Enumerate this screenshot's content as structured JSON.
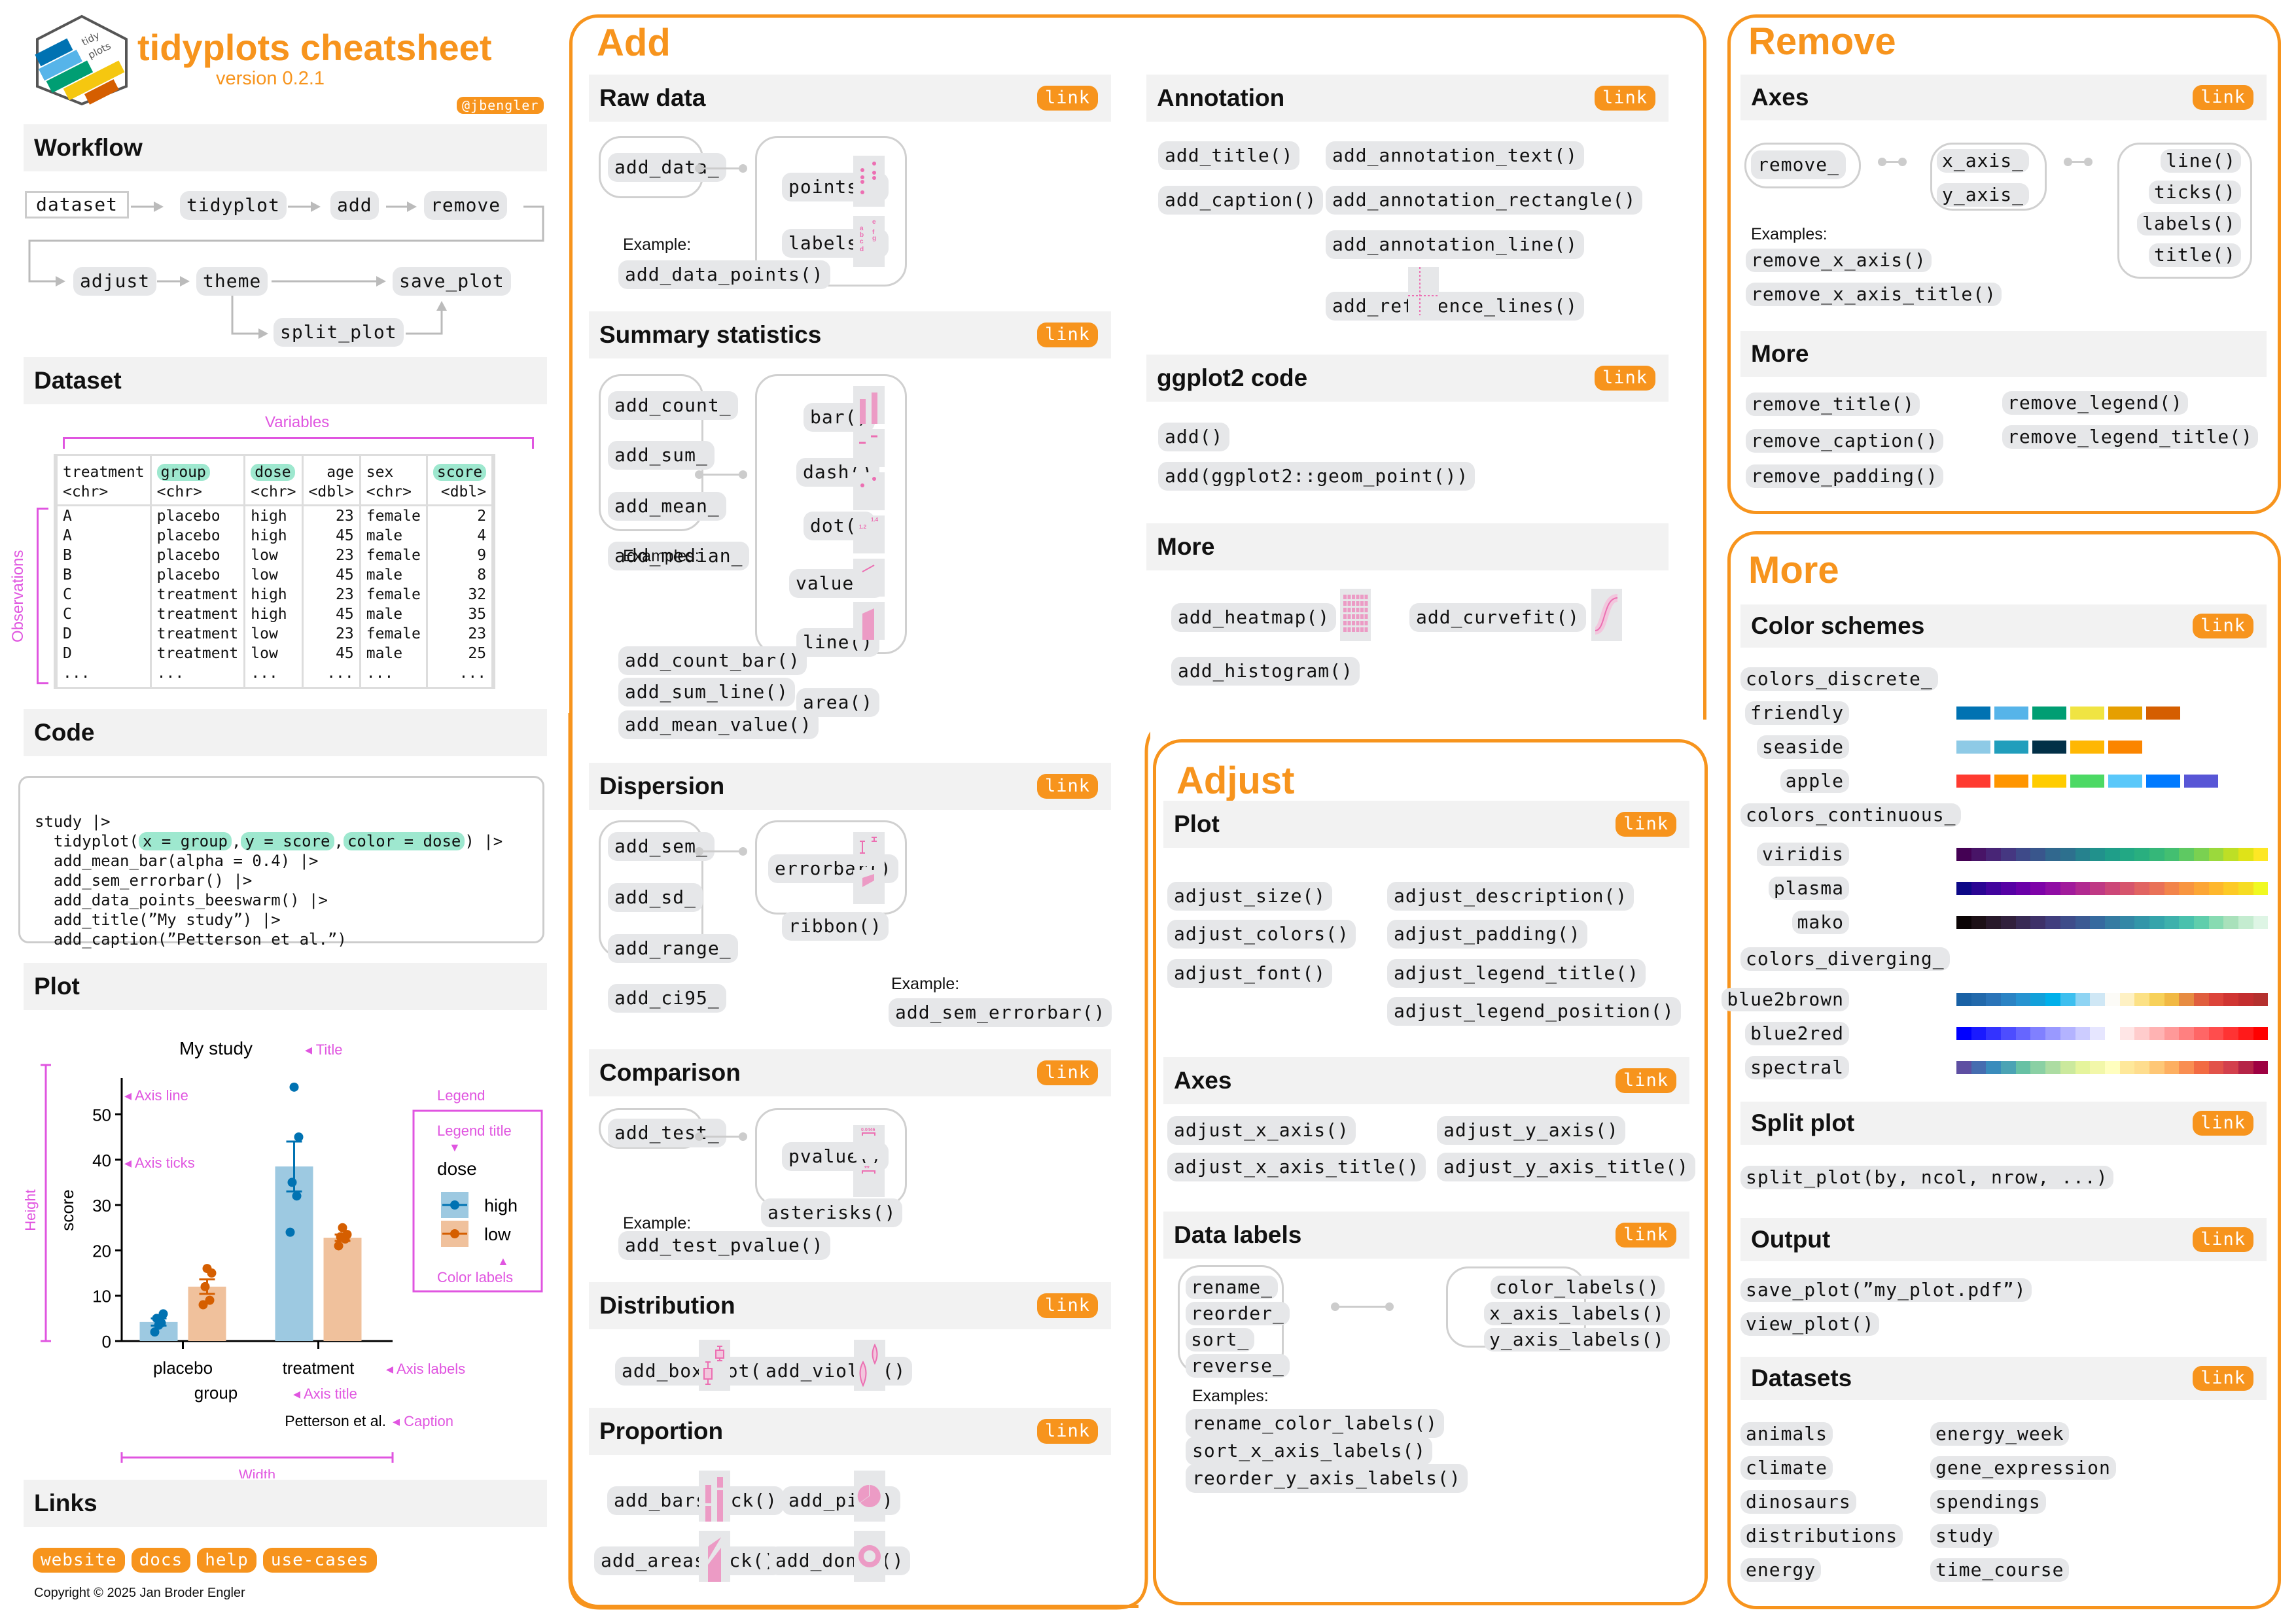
{
  "header": {
    "title": "tidyplots cheatsheet",
    "version": "version 0.2.1",
    "handle": "@jbengler",
    "logo_text": [
      "tidy",
      "plots"
    ],
    "logo_colors": [
      "#0072b2",
      "#56b4e9",
      "#009e73",
      "#f5c710",
      "#d55e00"
    ]
  },
  "accent_color": "#f7941d",
  "annotation_color": "#e055e0",
  "workflow": {
    "title": "Workflow",
    "steps": [
      "dataset",
      "tidyplot",
      "add",
      "remove",
      "adjust",
      "theme",
      "save_plot",
      "split_plot"
    ]
  },
  "dataset": {
    "title": "Dataset",
    "variables_label": "Variables",
    "observations_label": "Observations",
    "columns": [
      {
        "name": "treatment",
        "type": "<chr>",
        "highlight": false,
        "align": "left"
      },
      {
        "name": "group",
        "type": "<chr>",
        "highlight": true,
        "align": "left"
      },
      {
        "name": "dose",
        "type": "<chr>",
        "highlight": true,
        "align": "left"
      },
      {
        "name": "age",
        "type": "<dbl>",
        "highlight": false,
        "align": "right"
      },
      {
        "name": "sex",
        "type": "<chr>",
        "highlight": false,
        "align": "left"
      },
      {
        "name": "score",
        "type": "<dbl>",
        "highlight": true,
        "align": "right"
      }
    ],
    "rows": [
      [
        "A",
        "placebo",
        "high",
        "23",
        "female",
        "2"
      ],
      [
        "A",
        "placebo",
        "high",
        "45",
        "male",
        "4"
      ],
      [
        "B",
        "placebo",
        "low",
        "23",
        "female",
        "9"
      ],
      [
        "B",
        "placebo",
        "low",
        "45",
        "male",
        "8"
      ],
      [
        "C",
        "treatment",
        "high",
        "23",
        "female",
        "32"
      ],
      [
        "C",
        "treatment",
        "high",
        "45",
        "male",
        "35"
      ],
      [
        "D",
        "treatment",
        "low",
        "23",
        "female",
        "23"
      ],
      [
        "D",
        "treatment",
        "low",
        "45",
        "male",
        "25"
      ],
      [
        "...",
        "...",
        "...",
        "...",
        "...",
        "..."
      ]
    ]
  },
  "code": {
    "title": "Code",
    "line1": "study |>",
    "line2_pre": "tidyplot(",
    "line2_h1": "x = group",
    "line2_h2": "y = score",
    "line2_h3": "color = dose",
    "line2_post": ") |>",
    "lines": [
      "add_mean_bar(alpha = 0.4) |>",
      "add_sem_errorbar() |>",
      "add_data_points_beeswarm() |>",
      "add_title(”My study”) |>",
      "add_caption(”Petterson et al.”)"
    ]
  },
  "plot": {
    "title": "Plot",
    "annotations": {
      "title": "Title",
      "axis_line": "Axis line",
      "axis_ticks": "Axis ticks",
      "legend": "Legend",
      "legend_title": "Legend title",
      "color_labels": "Color labels",
      "axis_labels": "Axis labels",
      "axis_title": "Axis title",
      "caption": "Caption",
      "height": "Height",
      "width": "Width"
    }
  },
  "chart_data": {
    "type": "bar",
    "title": "My study",
    "caption": "Petterson et al.",
    "xlabel": "group",
    "ylabel": "score",
    "categories": [
      "placebo",
      "treatment"
    ],
    "ylim": [
      0,
      58
    ],
    "yticks": [
      0,
      10,
      20,
      30,
      40,
      50
    ],
    "legend": {
      "title": "dose",
      "position": "right"
    },
    "series": [
      {
        "name": "high",
        "color": "#0072b2",
        "fill": "#9dc9e1",
        "values": [
          4.2,
          38.5
        ],
        "sem": [
          0.8,
          5.5
        ],
        "points": [
          [
            2,
            4,
            5,
            6,
            3.5
          ],
          [
            24,
            32,
            35,
            45,
            56
          ]
        ]
      },
      {
        "name": "low",
        "color": "#d55e00",
        "fill": "#f0c19c",
        "values": [
          12,
          22.8
        ],
        "sem": [
          1.6,
          0.7
        ],
        "points": [
          [
            8,
            9,
            12,
            15,
            16
          ],
          [
            21,
            22.5,
            23,
            23.5,
            25
          ]
        ]
      }
    ]
  },
  "links": {
    "title": "Links",
    "items": [
      "website",
      "docs",
      "help",
      "use-cases"
    ],
    "copyright": "Copyright © 2025 Jan Broder Engler"
  },
  "add": {
    "title": "Add",
    "raw_data": {
      "title": "Raw data",
      "link": "link",
      "prefix": "add_data_",
      "suffixes": [
        "points()",
        "labels()"
      ],
      "example_label": "Example:",
      "examples": [
        "add_data_points()"
      ]
    },
    "summary": {
      "title": "Summary statistics",
      "link": "link",
      "prefixes": [
        "add_count_",
        "add_sum_",
        "add_mean_",
        "add_median_"
      ],
      "suffixes": [
        "bar()",
        "dash()",
        "dot()",
        "value()",
        "line()",
        "area()"
      ],
      "example_label": "Examples:",
      "examples": [
        "add_count_bar()",
        "add_sum_line()",
        "add_mean_value()"
      ],
      "value_icon_labels": [
        "1.2",
        "1.4"
      ]
    },
    "dispersion": {
      "title": "Dispersion",
      "link": "link",
      "prefixes": [
        "add_sem_",
        "add_sd_",
        "add_range_",
        "add_ci95_"
      ],
      "suffixes": [
        "errorbar()",
        "ribbon()"
      ],
      "example_label": "Example:",
      "examples": [
        "add_sem_errorbar()"
      ]
    },
    "comparison": {
      "title": "Comparison",
      "link": "link",
      "prefix": "add_test_",
      "suffixes": [
        "pvalue()",
        "asterisks()"
      ],
      "example_label": "Example:",
      "examples": [
        "add_test_pvalue()"
      ],
      "pvalue_icon_label": "0.0446",
      "asterisks_icon_label": "**"
    },
    "distribution": {
      "title": "Distribution",
      "link": "link",
      "items": [
        "add_boxplot()",
        "add_violin()"
      ]
    },
    "proportion": {
      "title": "Proportion",
      "link": "link",
      "items": [
        "add_barstack()",
        "add_pie()",
        "add_areastack()",
        "add_donut()"
      ]
    },
    "annotation": {
      "title": "Annotation",
      "link": "link",
      "items": [
        "add_title()",
        "add_annotation_text()",
        "add_caption()",
        "add_annotation_rectangle()",
        "add_annotation_line()",
        "add_reference_lines()"
      ]
    },
    "ggplot2": {
      "title": "ggplot2 code",
      "link": "link",
      "items": [
        "add()",
        "add(ggplot2::geom_point())"
      ]
    },
    "more": {
      "title": "More",
      "items": [
        "add_heatmap()",
        "add_curvefit()",
        "add_histogram()"
      ]
    }
  },
  "adjust": {
    "title": "Adjust",
    "plot": {
      "title": "Plot",
      "link": "link",
      "items": [
        "adjust_size()",
        "adjust_description()",
        "adjust_colors()",
        "adjust_padding()",
        "adjust_font()",
        "adjust_legend_title()",
        "adjust_legend_position()"
      ]
    },
    "axes": {
      "title": "Axes",
      "link": "link",
      "items": [
        "adjust_x_axis()",
        "adjust_y_axis()",
        "adjust_x_axis_title()",
        "adjust_y_axis_title()"
      ]
    },
    "data_labels": {
      "title": "Data labels",
      "link": "link",
      "prefixes": [
        "rename_",
        "reorder_",
        "sort_",
        "reverse_"
      ],
      "suffixes": [
        "color_labels()",
        "x_axis_labels()",
        "y_axis_labels()"
      ],
      "example_label": "Examples:",
      "examples": [
        "rename_color_labels()",
        "sort_x_axis_labels()",
        "reorder_y_axis_labels()"
      ]
    }
  },
  "remove": {
    "title": "Remove",
    "axes": {
      "title": "Axes",
      "link": "link",
      "prefix": "remove_",
      "middle": [
        "x_axis_",
        "y_axis_"
      ],
      "suffixes": [
        "line()",
        "ticks()",
        "labels()",
        "title()"
      ],
      "example_label": "Examples:",
      "examples": [
        "remove_x_axis()",
        "remove_x_axis_title()"
      ]
    },
    "more": {
      "title": "More",
      "items": [
        "remove_title()",
        "remove_legend()",
        "remove_caption()",
        "remove_legend_title()",
        "remove_padding()"
      ]
    }
  },
  "more": {
    "title": "More",
    "color_schemes": {
      "title": "Color schemes",
      "link": "link",
      "discrete_label": "colors_discrete_",
      "discrete": [
        {
          "name": "friendly",
          "colors": [
            "#0072b2",
            "#56b4e9",
            "#009e73",
            "#f0e442",
            "#e69f00",
            "#d55e00"
          ]
        },
        {
          "name": "seaside",
          "colors": [
            "#8ecae6",
            "#219ebc",
            "#023047",
            "#ffb703",
            "#fb8500"
          ]
        },
        {
          "name": "apple",
          "colors": [
            "#ff3b30",
            "#ff9500",
            "#ffcc00",
            "#4cd964",
            "#5ac8fa",
            "#007aff",
            "#5856d6"
          ]
        }
      ],
      "continuous_label": "colors_continuous_",
      "continuous": [
        {
          "name": "viridis",
          "colors": [
            "#440154",
            "#481467",
            "#482576",
            "#453781",
            "#3e4a89",
            "#39568c",
            "#31688e",
            "#2d708e",
            "#26828e",
            "#21918c",
            "#1f9e89",
            "#22a884",
            "#29af7f",
            "#35b779",
            "#43bf71",
            "#5ec962",
            "#7ad151",
            "#9bd93c",
            "#bddf26",
            "#dfe318",
            "#fde725"
          ]
        },
        {
          "name": "plasma",
          "colors": [
            "#0d0887",
            "#2a0593",
            "#41049d",
            "#5601a4",
            "#6a00a8",
            "#7e03a8",
            "#8f0da4",
            "#a11b9b",
            "#b12a90",
            "#bf3984",
            "#cc4778",
            "#d6556d",
            "#e16462",
            "#e97158",
            "#f2844b",
            "#f89540",
            "#fca636",
            "#feb72d",
            "#fdca26",
            "#f6dc22",
            "#f0f921"
          ]
        },
        {
          "name": "mako",
          "colors": [
            "#0b0405",
            "#1c1016",
            "#28192a",
            "#31203c",
            "#382a54",
            "#3e3169",
            "#413e7e",
            "#3e4c8a",
            "#3b5a93",
            "#366a9f",
            "#357ba2",
            "#3487a6",
            "#3396a9",
            "#35a4ab",
            "#3eb1ac",
            "#49c1ad",
            "#60ceac",
            "#87dbb2",
            "#a9e1bb",
            "#c4ecd0",
            "#def5e5"
          ]
        }
      ],
      "diverging_label": "colors_diverging_",
      "diverging": [
        {
          "name": "blue2brown",
          "colors": [
            "#1961a5",
            "#2269ab",
            "#2a74b8",
            "#2b83c4",
            "#2793d1",
            "#12a0da",
            "#00b0ea",
            "#3dbfef",
            "#8fd4f3",
            "#cfe7f5",
            "#fcfbf7",
            "#fef1c4",
            "#fce185",
            "#f7d15a",
            "#f1b944",
            "#e78c42",
            "#e05e3e",
            "#dc443a",
            "#d03532",
            "#c32e2f",
            "#b4302e"
          ]
        },
        {
          "name": "blue2red",
          "colors": [
            "#0000ff",
            "#1a1aff",
            "#3333ff",
            "#4d4dff",
            "#6666ff",
            "#8080ff",
            "#9999ff",
            "#b3b3ff",
            "#ccccff",
            "#e6e6ff",
            "#ffffff",
            "#ffe6e6",
            "#ffcccc",
            "#ffb3b3",
            "#ff9999",
            "#ff8080",
            "#ff6666",
            "#ff4d4d",
            "#ff3333",
            "#ff1a1a",
            "#ff0000"
          ]
        },
        {
          "name": "spectral",
          "colors": [
            "#5e4fa2",
            "#466db0",
            "#3a8cbc",
            "#4ba3b4",
            "#67c1a4",
            "#8ad0a4",
            "#acdca2",
            "#cbe99d",
            "#e5f49c",
            "#f2f7a9",
            "#fffebe",
            "#fee89a",
            "#fedd8e",
            "#fec776",
            "#fdaf61",
            "#f98e52",
            "#f26b43",
            "#e2534a",
            "#d3404d",
            "#b52447",
            "#9e0142"
          ]
        }
      ]
    },
    "split_plot": {
      "title": "Split plot",
      "link": "link",
      "items": [
        "split_plot(by, ncol, nrow, ...)"
      ]
    },
    "output": {
      "title": "Output",
      "link": "link",
      "items": [
        "save_plot(”my_plot.pdf”)",
        "view_plot()"
      ]
    },
    "datasets": {
      "title": "Datasets",
      "link": "link",
      "items": [
        "animals",
        "energy_week",
        "climate",
        "gene_expression",
        "dinosaurs",
        "spendings",
        "distributions",
        "study",
        "energy",
        "time_course"
      ]
    }
  }
}
